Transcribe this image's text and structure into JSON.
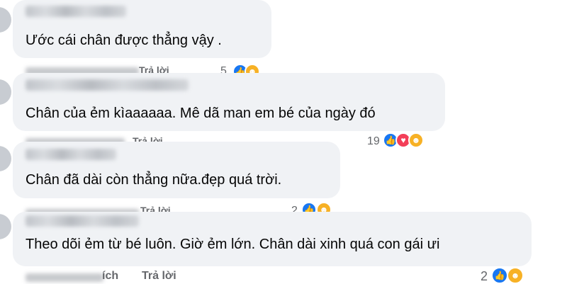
{
  "comments": [
    {
      "text": "Ước cái chân được thẳng vậy .",
      "meta": {
        "reply_label": "Trả lời",
        "reaction_count": "5"
      }
    },
    {
      "text": "Chân của ẻm kìaaaaaa. Mê dã man em bé của ngày đó",
      "meta": {
        "reply_label": "Trả lời",
        "reaction_count": "19"
      }
    },
    {
      "text": "Chân đã dài còn thẳng nữa.đẹp quá trời.",
      "meta": {
        "reply_label": "Trả lời",
        "reaction_count": "2"
      }
    },
    {
      "text": "Theo dõi ẻm từ bé luôn. Giờ ẻm lớn. Chân dài xinh quá con gái ưi",
      "meta": {
        "like_label": "ích",
        "reply_label": "Trả lời",
        "reaction_count": "2"
      }
    }
  ],
  "icons": {
    "like": "like-icon",
    "love": "love-icon",
    "care": "care-icon",
    "wow": "wow-icon"
  },
  "colors": {
    "bubble": "#f0f2f5",
    "meta_text": "#65676b",
    "like": "#1877f2",
    "love": "#f33e58",
    "care": "#f7b125"
  }
}
